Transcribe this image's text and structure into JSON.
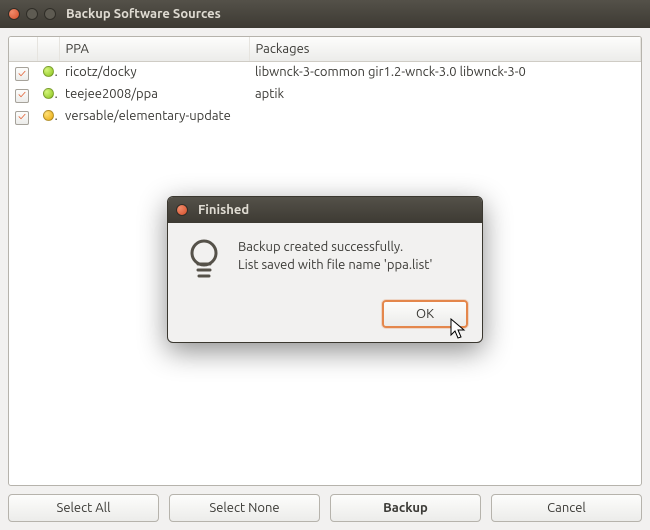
{
  "window": {
    "title": "Backup Software Sources"
  },
  "columns": {
    "ppa": "PPA",
    "packages": "Packages"
  },
  "rows": [
    {
      "checked": true,
      "status": "green",
      "ppa": "ricotz/docky",
      "packages": "libwnck-3-common gir1.2-wnck-3.0 libwnck-3-0"
    },
    {
      "checked": true,
      "status": "green",
      "ppa": "teejee2008/ppa",
      "packages": "aptik"
    },
    {
      "checked": true,
      "status": "amber",
      "ppa": "versable/elementary-update",
      "packages": ""
    }
  ],
  "buttons": {
    "select_all": "Select All",
    "select_none": "Select None",
    "backup": "Backup",
    "cancel": "Cancel"
  },
  "dialog": {
    "title": "Finished",
    "line1": "Backup created successfully.",
    "line2": "List saved with file name 'ppa.list'",
    "ok": "OK"
  }
}
